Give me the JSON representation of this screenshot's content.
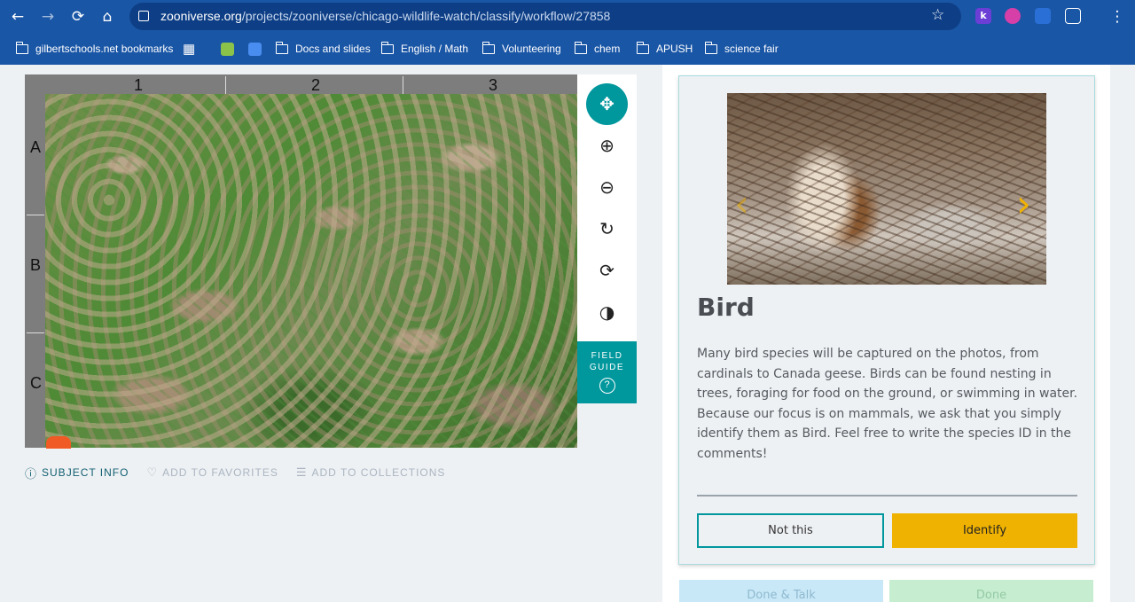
{
  "browser": {
    "url_host": "zooniverse.org",
    "url_path": "/projects/zooniverse/chicago-wildlife-watch/classify/workflow/27858",
    "bookmarks": [
      {
        "label": "gilbertschools.net bookmarks",
        "icon": "bookmarks-folder-icon"
      },
      {
        "label": "Docs and slides",
        "icon": "folder-icon"
      },
      {
        "label": "English / Math",
        "icon": "folder-icon"
      },
      {
        "label": "Volunteering",
        "icon": "folder-icon"
      },
      {
        "label": "chem",
        "icon": "folder-icon"
      },
      {
        "label": "APUSH",
        "icon": "folder-icon"
      },
      {
        "label": "science fair",
        "icon": "folder-icon"
      }
    ],
    "extension_letter": "k",
    "colors": {
      "chrome": "#1a56a6",
      "urlbar": "#0e3f86"
    }
  },
  "viewer": {
    "columns": [
      "1",
      "2",
      "3"
    ],
    "rows": [
      "A",
      "B",
      "C"
    ],
    "tools": [
      "move-icon",
      "zoom-in-icon",
      "zoom-out-icon",
      "rotate-icon",
      "reset-icon",
      "invert-icon"
    ],
    "field_guide_line1": "FIELD",
    "field_guide_line2": "GUIDE",
    "field_guide_q": "?"
  },
  "meta": {
    "subject_info": "SUBJECT INFO",
    "add_favorites": "ADD TO FAVORITES",
    "add_collections": "ADD TO COLLECTIONS"
  },
  "card": {
    "title": "Bird",
    "description": "Many bird species will be captured on the photos, from cardinals to Canada geese. Birds can be found nesting in trees, foraging for food on the ground, or swimming in water. Because our focus is on mammals, we ask that you simply identify them as Bird. Feel free to write the species ID in the comments!",
    "not_this": "Not this",
    "identify": "Identify"
  },
  "footer": {
    "done_talk": "Done & Talk",
    "done": "Done"
  },
  "colors": {
    "accent": "#00979d",
    "identify": "#f0b200"
  }
}
